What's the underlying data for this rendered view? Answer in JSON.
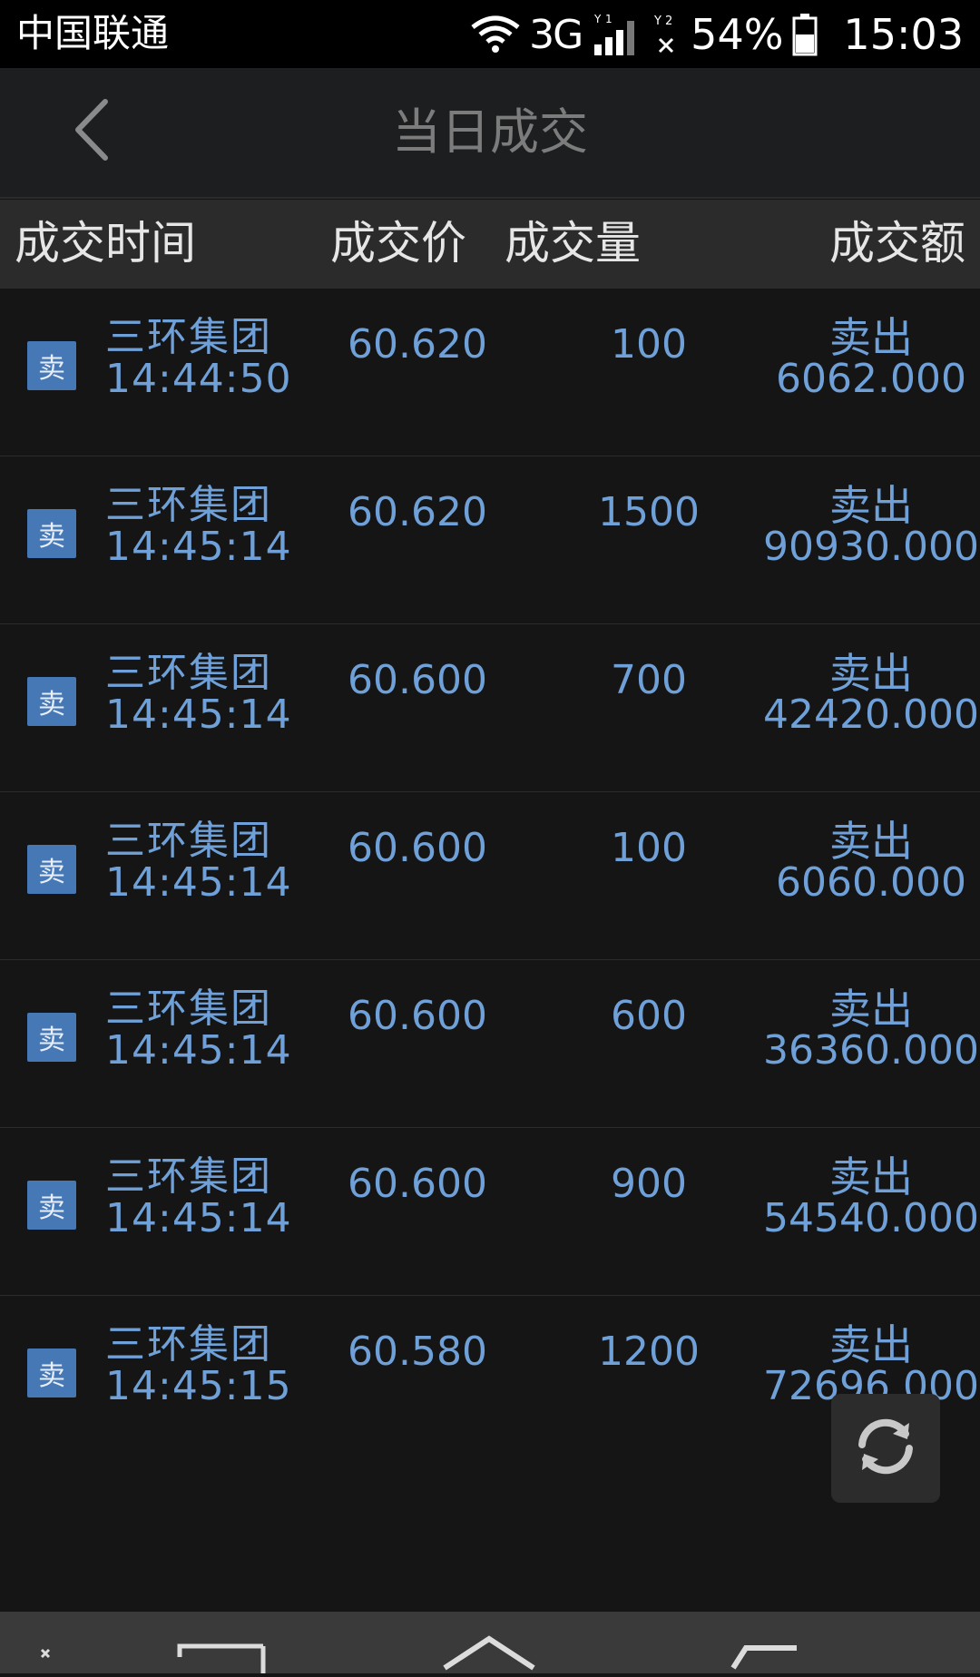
{
  "status_bar": {
    "carrier": "中国联通",
    "network": "3G",
    "sim1_label": "1",
    "sim2_label": "2",
    "battery_percent": "54%",
    "time": "15:03",
    "icons": [
      "wifi-icon",
      "signal-icon",
      "no-signal-icon",
      "battery-icon"
    ]
  },
  "nav": {
    "title": "当日成交",
    "back_icon": "chevron-left-icon"
  },
  "table": {
    "headers": {
      "time": "成交时间",
      "price": "成交价",
      "volume": "成交量",
      "amount": "成交额"
    },
    "rows": [
      {
        "badge": "卖",
        "name": "三环集团",
        "time": "14:44:50",
        "price": "60.620",
        "volume": "100",
        "direction": "卖出",
        "amount": "6062.000"
      },
      {
        "badge": "卖",
        "name": "三环集团",
        "time": "14:45:14",
        "price": "60.620",
        "volume": "1500",
        "direction": "卖出",
        "amount": "90930.000"
      },
      {
        "badge": "卖",
        "name": "三环集团",
        "time": "14:45:14",
        "price": "60.600",
        "volume": "700",
        "direction": "卖出",
        "amount": "42420.000"
      },
      {
        "badge": "卖",
        "name": "三环集团",
        "time": "14:45:14",
        "price": "60.600",
        "volume": "100",
        "direction": "卖出",
        "amount": "6060.000"
      },
      {
        "badge": "卖",
        "name": "三环集团",
        "time": "14:45:14",
        "price": "60.600",
        "volume": "600",
        "direction": "卖出",
        "amount": "36360.000"
      },
      {
        "badge": "卖",
        "name": "三环集团",
        "time": "14:45:14",
        "price": "60.600",
        "volume": "900",
        "direction": "卖出",
        "amount": "54540.000"
      },
      {
        "badge": "卖",
        "name": "三环集团",
        "time": "14:45:15",
        "price": "60.580",
        "volume": "1200",
        "direction": "卖出",
        "amount": "72696.000"
      }
    ]
  },
  "refresh": {
    "icon": "refresh-icon"
  },
  "system_nav": {
    "icons": [
      "menu-icon",
      "home-icon",
      "back-icon"
    ]
  },
  "colors": {
    "background": "#151515",
    "header_bg": "#2b2b2b",
    "nav_bg": "#1d1e1f",
    "accent_text": "#6fa0d8",
    "badge_bg": "#4678b6"
  }
}
